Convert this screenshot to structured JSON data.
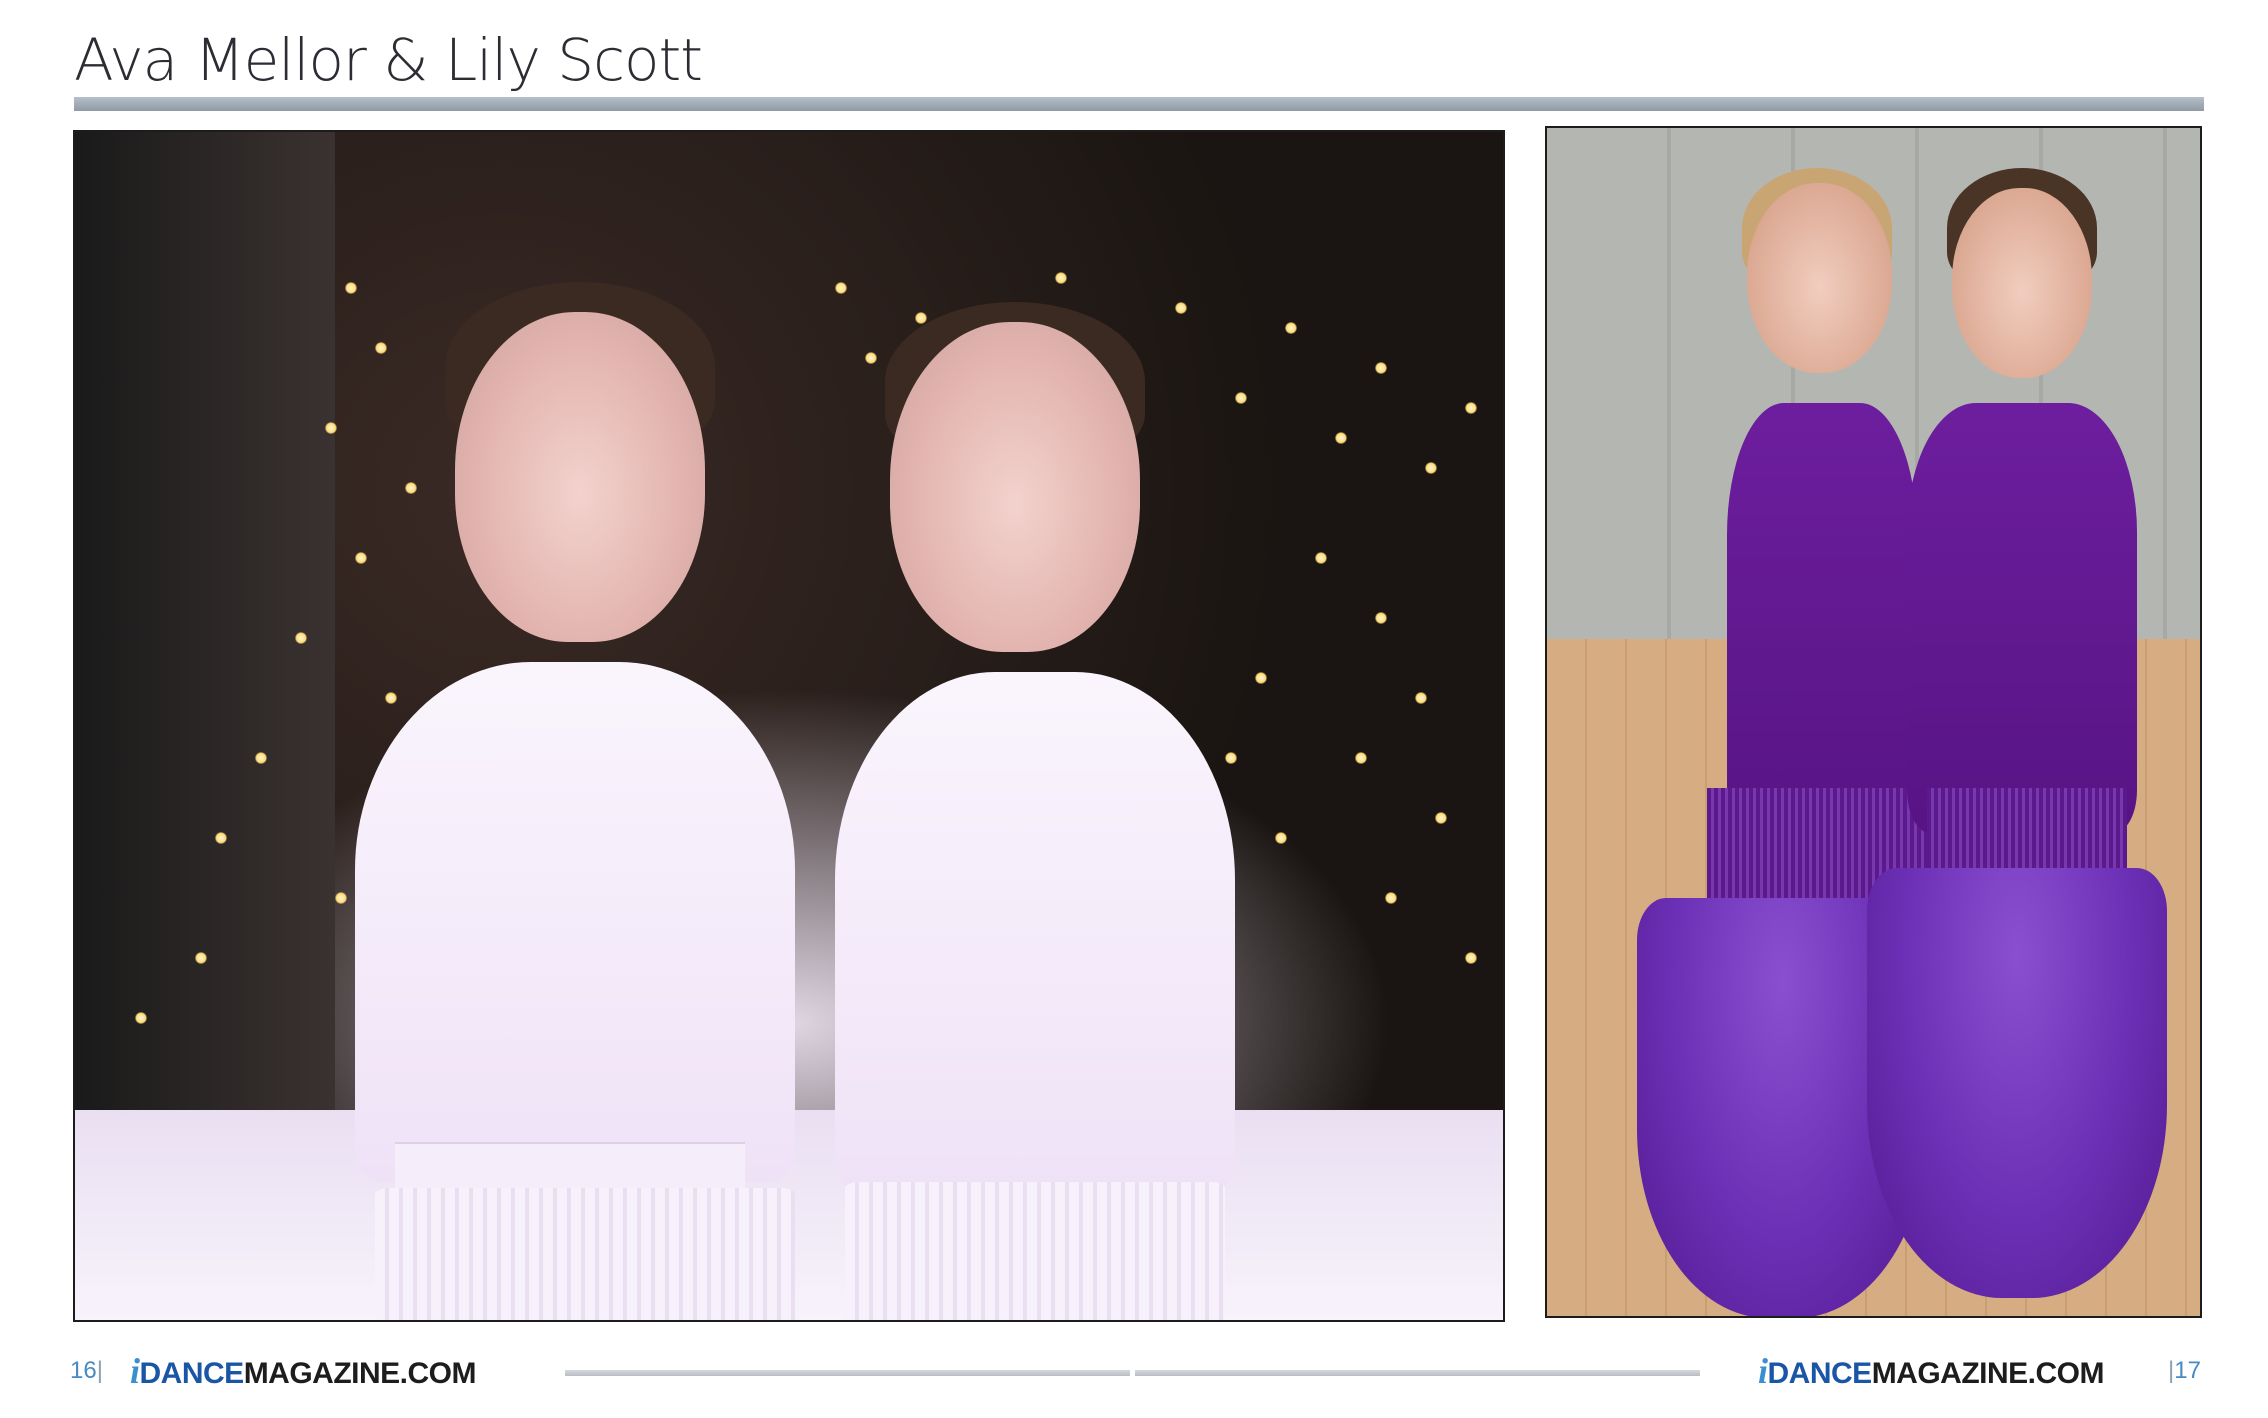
{
  "header": {
    "title": "Ava Mellor & Lily Scott"
  },
  "photos": {
    "left": {
      "subject": "two-dancers-white-outfits"
    },
    "right": {
      "subject": "two-dancers-purple-ballroom-dresses"
    }
  },
  "footer": {
    "left_page": "16",
    "right_page": "17",
    "separator": "|",
    "logo": {
      "i": "i",
      "dance": "DANCE",
      "magazine": "MAGAZINE.COM"
    }
  },
  "colors": {
    "title_rule": "#8e9aa6",
    "brand_blue": "#1a56a6",
    "page_number_blue": "#4a8ac2",
    "gown_purple": "#6b2fb5"
  }
}
